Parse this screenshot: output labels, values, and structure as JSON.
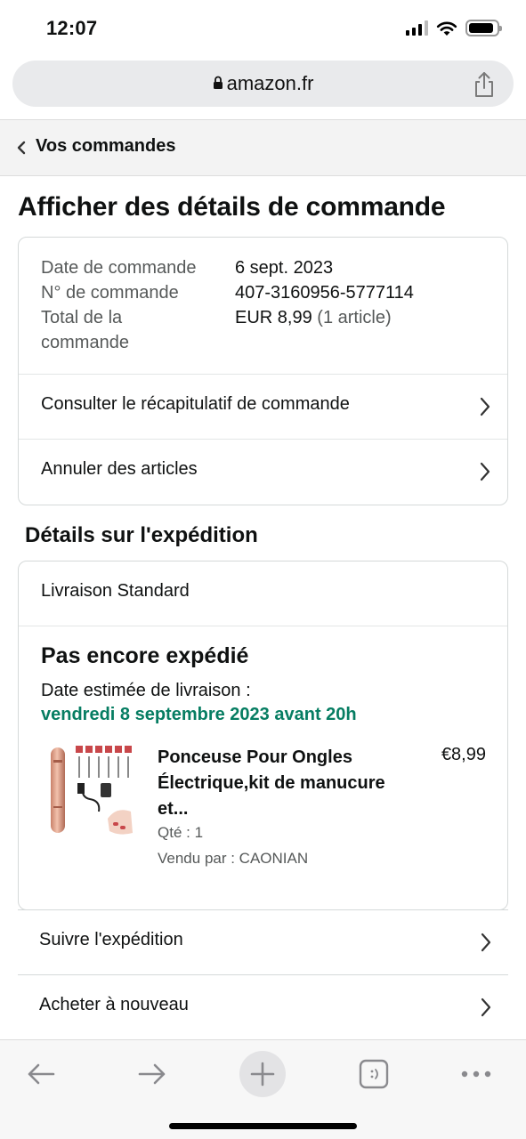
{
  "status_bar": {
    "time": "12:07",
    "battery_level": 0.9
  },
  "browser": {
    "url": "amazon.fr",
    "icons": [
      "lock-icon",
      "share-icon"
    ]
  },
  "nav": {
    "back_label": "Vos commandes"
  },
  "page_title": "Afficher des détails de commande",
  "order_summary": {
    "rows": [
      {
        "key": "Date de commande",
        "value": "6 sept. 2023",
        "extra": ""
      },
      {
        "key": "N° de commande",
        "value": "407-3160956-5777114",
        "extra": ""
      },
      {
        "key": "Total de la commande",
        "value": "EUR 8,99",
        "extra": "(1 article)"
      }
    ],
    "links": [
      {
        "label": "Consulter le récapitulatif de commande"
      },
      {
        "label": "Annuler des articles"
      }
    ]
  },
  "shipment": {
    "section_title": "Détails sur l'expédition",
    "method": "Livraison Standard",
    "status": "Pas encore expédié",
    "estimate_label": "Date estimée de livraison :",
    "estimate_date": "vendredi 8 septembre 2023 avant 20h",
    "accent_color": "#067d62",
    "item": {
      "title": "Ponceuse Pour Ongles Électrique,kit de manucure et...",
      "price": "€8,99",
      "quantity": "Qté : 1",
      "seller": "Vendu par : CAONIAN"
    }
  },
  "actions": [
    {
      "label": "Suivre l'expédition"
    },
    {
      "label": "Acheter à nouveau"
    }
  ],
  "toolbar": {
    "icons": [
      "back-arrow-icon",
      "forward-arrow-icon",
      "new-tab-plus-icon",
      "tabs-icon",
      "more-icon"
    ]
  }
}
